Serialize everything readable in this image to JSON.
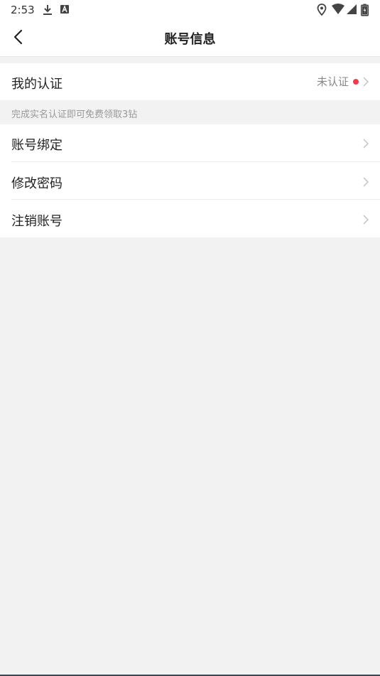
{
  "status_bar": {
    "time": "2:53",
    "icons": [
      "download-icon",
      "keyboard-a-icon",
      "location-icon",
      "wifi-icon",
      "signal-icon",
      "battery-icon"
    ]
  },
  "nav": {
    "title": "账号信息",
    "back_icon": "chevron-left-icon"
  },
  "verification": {
    "label": "我的认证",
    "status": "未认证",
    "dot_color": "#f03a4a"
  },
  "hint": "完成实名认证即可免费领取3钻",
  "menu": [
    {
      "label": "账号绑定"
    },
    {
      "label": "修改密码"
    },
    {
      "label": "注销账号"
    }
  ]
}
